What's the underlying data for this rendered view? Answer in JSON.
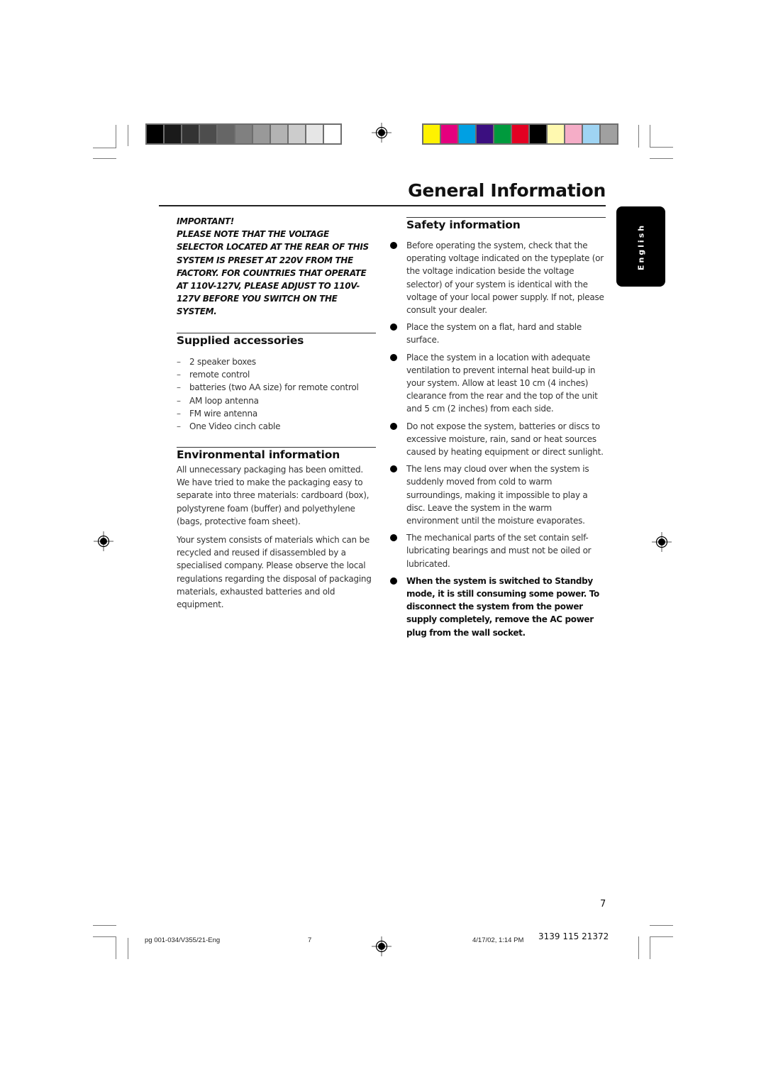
{
  "color_bars": {
    "grayscale": [
      "#000000",
      "#1a1a1a",
      "#333333",
      "#4d4d4d",
      "#666666",
      "#808080",
      "#999999",
      "#b3b3b3",
      "#cccccc",
      "#e6e6e6",
      "#ffffff"
    ],
    "process": [
      "#fff200",
      "#e5007e",
      "#00a0e3",
      "#3b0f80",
      "#009a3d",
      "#e30022",
      "#000000",
      "#fff9b0",
      "#f5adc7",
      "#9fd4f3",
      "#a0a0a0"
    ]
  },
  "header": {
    "title": "General Information"
  },
  "language_tab": {
    "label": "English"
  },
  "important": {
    "label": "IMPORTANT!",
    "text": "PLEASE NOTE THAT THE VOLTAGE SELECTOR LOCATED AT THE REAR OF THIS SYSTEM IS PRESET AT 220V FROM THE FACTORY. FOR COUNTRIES THAT OPERATE AT 110V-127V, PLEASE ADJUST TO 110V-127V BEFORE YOU SWITCH ON THE SYSTEM."
  },
  "supplied_accessories": {
    "heading": "Supplied accessories",
    "items": [
      "2 speaker boxes",
      "remote control",
      "batteries (two AA size) for remote control",
      "AM loop antenna",
      "FM wire antenna",
      "One Video cinch cable"
    ]
  },
  "environmental": {
    "heading": "Environmental information",
    "paragraphs": [
      "All unnecessary packaging has been omitted. We have tried to make the packaging easy to separate into three materials: cardboard (box), polystyrene foam (buffer) and polyethylene (bags, protective foam sheet).",
      "Your system consists of materials which can be recycled and reused if disassembled by a specialised company. Please observe the local regulations regarding the disposal of packaging materials, exhausted batteries and old equipment."
    ]
  },
  "safety": {
    "heading": "Safety information",
    "items": [
      "Before operating the system, check that the operating voltage indicated on the typeplate (or the voltage indication beside the voltage selector) of your system is identical with the voltage of your local power supply. If not, please consult your dealer.",
      "Place the system on a flat, hard and stable surface.",
      "Place the system in a location with adequate ventilation to prevent internal heat build-up in your system.  Allow at least 10 cm (4 inches) clearance from the rear and the top of the unit and 5 cm (2 inches) from each side.",
      "Do not expose the system, batteries or discs to excessive moisture, rain, sand or heat sources caused by heating equipment or direct sunlight.",
      "The lens may cloud over when the system is suddenly moved from cold to warm surroundings, making it impossible to play a disc. Leave the system in the warm environment until the moisture evaporates.",
      "The mechanical parts of the set contain self-lubricating bearings and must not be oiled or lubricated.",
      "When the system is switched to Standby mode, it is still consuming some power. To disconnect the system from the power supply completely, remove the AC power plug from the wall socket."
    ]
  },
  "footer": {
    "page_number": "7",
    "file_name": "pg 001-034/V355/21-Eng",
    "file_page": "7",
    "timestamp": "4/17/02, 1:14 PM",
    "code": "3139 115 21372"
  }
}
